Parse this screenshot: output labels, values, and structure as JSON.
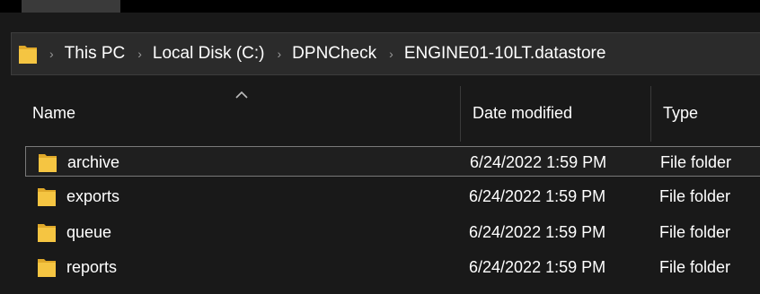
{
  "breadcrumb": {
    "items": [
      "This PC",
      "Local Disk (C:)",
      "DPNCheck",
      "ENGINE01-10LT.datastore"
    ],
    "separator": "›"
  },
  "columns": {
    "name": "Name",
    "date_modified": "Date modified",
    "type": "Type"
  },
  "files": [
    {
      "name": "archive",
      "date_modified": "6/24/2022 1:59 PM",
      "type": "File folder",
      "selected": true
    },
    {
      "name": "exports",
      "date_modified": "6/24/2022 1:59 PM",
      "type": "File folder",
      "selected": false
    },
    {
      "name": "queue",
      "date_modified": "6/24/2022 1:59 PM",
      "type": "File folder",
      "selected": false
    },
    {
      "name": "reports",
      "date_modified": "6/24/2022 1:59 PM",
      "type": "File folder",
      "selected": false
    }
  ],
  "colors": {
    "background": "#191919",
    "folder": "#f5c542",
    "folder_dark": "#e0a92a"
  },
  "icons": {
    "folder": "folder-icon",
    "sort": "sort-ascending-icon",
    "separator": "chevron-right-icon"
  }
}
